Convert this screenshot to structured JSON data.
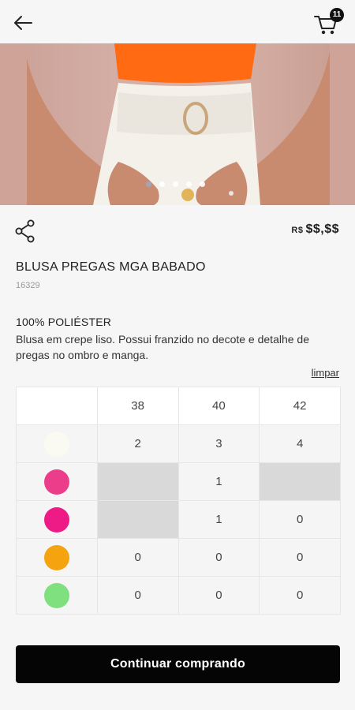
{
  "header": {
    "back_icon": "arrow-left-icon",
    "cart_icon": "shopping-cart-icon",
    "cart_count": "11"
  },
  "carousel": {
    "total_dots": 5,
    "active_index": 0
  },
  "product": {
    "share_icon": "share-icon",
    "currency": "R$",
    "price": "$$,$$",
    "title": "BLUSA PREGAS MGA BABADO",
    "sku": "16329",
    "material": "100% POLIÉSTER",
    "description": "Blusa em crepe liso. Possui franzido no decote e detalhe de pregas no ombro e manga."
  },
  "grid": {
    "clear_label": "limpar",
    "sizes": [
      "38",
      "40",
      "42"
    ],
    "rows": [
      {
        "color": "#fafaf2",
        "cells": [
          "2",
          "3",
          "4"
        ]
      },
      {
        "color": "#ec3d8b",
        "cells": [
          "",
          "1",
          ""
        ]
      },
      {
        "color": "#ee1b87",
        "cells": [
          "",
          "1",
          "0"
        ]
      },
      {
        "color": "#f5a30f",
        "cells": [
          "0",
          "0",
          "0"
        ]
      },
      {
        "color": "#7fe080",
        "cells": [
          "0",
          "0",
          "0"
        ]
      }
    ]
  },
  "cta": {
    "label": "Continuar comprando"
  }
}
